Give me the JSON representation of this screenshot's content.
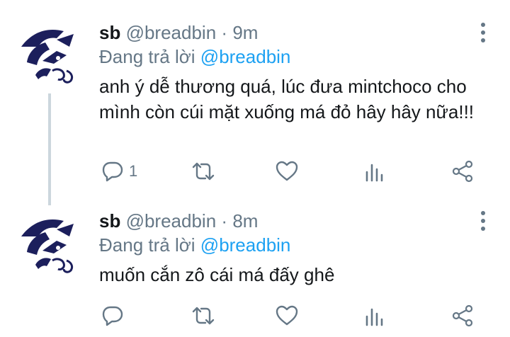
{
  "tweets": [
    {
      "display_name": "sb",
      "handle": "@breadbin",
      "separator": "·",
      "time": "9m",
      "reply_prefix": "Đang trả lời",
      "reply_to": "@breadbin",
      "text": "anh ý dễ thương quá, lúc đưa mintchoco cho mình còn cúi mặt xuống má đỏ hây hây nữa!!!",
      "reply_count": "1"
    },
    {
      "display_name": "sb",
      "handle": "@breadbin",
      "separator": "·",
      "time": "8m",
      "reply_prefix": "Đang trả lời",
      "reply_to": "@breadbin",
      "text": "muốn cắn zô cái má đấy ghê",
      "reply_count": ""
    }
  ],
  "colors": {
    "text_primary": "#14171a",
    "text_secondary": "#657786",
    "accent": "#1da1f2",
    "thread_line": "#ccd6dd",
    "avatar_ink": "#1c1f5c"
  },
  "icons": [
    "more-vertical-icon",
    "reply-icon",
    "retweet-icon",
    "heart-icon",
    "stats-icon",
    "share-icon"
  ]
}
